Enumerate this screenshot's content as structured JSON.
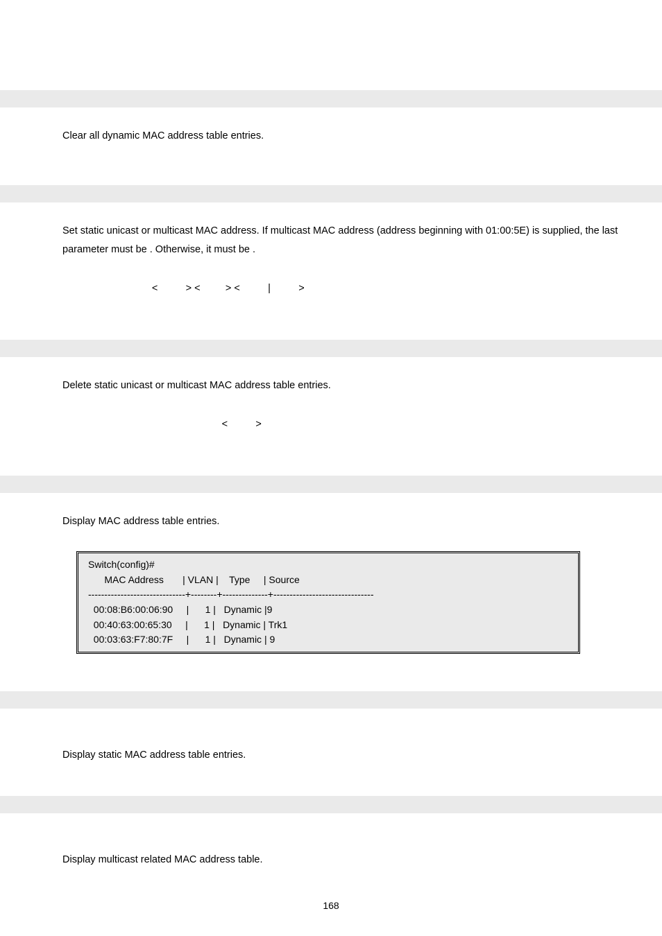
{
  "sections": [
    {
      "para": "Clear all dynamic MAC address table entries."
    },
    {
      "para_prefix": "Set static unicast or multicast MAC address. If multicast MAC address (address beginning with 01:00:5E) is supplied, the last parameter must be ",
      "para_mid1": ". Otherwise, it must be ",
      "para_suffix": ".",
      "syntax": "                                <          > <         > <          |          >"
    },
    {
      "para": "Delete static unicast or multicast MAC address table entries.",
      "syntax": "                                                         <          >"
    },
    {
      "para": "Display MAC address table entries.",
      "code": {
        "prompt": "Switch(config)#",
        "header": "      MAC Address       | VLAN |    Type     | Source",
        "sep": "------------------------------+--------+--------------+-------------------------------",
        "rows": [
          "  00:08:B6:00:06:90     |      1 |   Dynamic |9",
          "  00:40:63:00:65:30     |      1 |   Dynamic | Trk1",
          "  00:03:63:F7:80:7F     |      1 |   Dynamic | 9"
        ]
      }
    },
    {
      "para": "Display static MAC address table entries."
    },
    {
      "para": "Display multicast related MAC address table."
    }
  ],
  "page_number": "168"
}
